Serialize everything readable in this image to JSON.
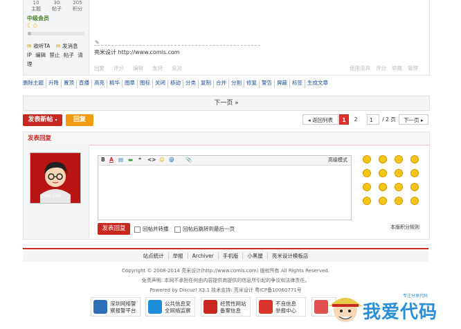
{
  "author_stats": [
    {
      "value": "10",
      "label": "主题"
    },
    {
      "value": "30",
      "label": "帖子"
    },
    {
      "value": "205",
      "label": "积分"
    }
  ],
  "author": {
    "grade": "中级会员",
    "level_progress": 0.06,
    "links_row1": [
      "收听TA",
      "发消息"
    ],
    "links_row2": [
      "IP",
      "编辑",
      "禁止",
      "帖子",
      "清理"
    ]
  },
  "post": {
    "signature": "亮米设计 http://www.comis.com",
    "actions": [
      "回复",
      "评分",
      "编辑",
      "支持",
      "反对"
    ],
    "actions_right": [
      "使用道具",
      "评分",
      "举报",
      "管理"
    ]
  },
  "mod_actions": [
    "删除主题",
    "升降",
    "置顶",
    "直播",
    "高亮",
    "精华",
    "图章",
    "图标",
    "关闭",
    "移动",
    "分类",
    "复制",
    "合并",
    "分割",
    "修复",
    "警告",
    "屏蔽",
    "标签",
    "生成文章"
  ],
  "next_page": "下一页 »",
  "buttons": {
    "new_post": "发表新帖",
    "reply": "回复"
  },
  "pagination": {
    "back": "◂ 返回列表",
    "pages": [
      "1",
      "2"
    ],
    "current": "1",
    "total": "/ 2 页",
    "next": "下一页 ▸"
  },
  "reply": {
    "header": "发表回复",
    "advanced_mode": "高级模式",
    "toolbar": [
      "B",
      "A",
      "▤",
      "▬",
      "❝",
      "<>",
      "☺",
      "@",
      "📎"
    ],
    "submit": "发表回复",
    "checkbox1": "回帖并转播",
    "checkbox2": "回帖后跳转到最后一页",
    "bonus_rules": "本版积分规则",
    "avatar_text": "COMIS.COM"
  },
  "footer": {
    "nav": [
      "站点统计",
      "举报",
      "Archiver",
      "手机版",
      "小黑屋",
      "亮米设计模板店"
    ],
    "copyright": "Copyright © 2008-2014 亮米设计(http://www.comis.com) 版权所有 All Rights Reserved.",
    "disclaimer": "免责声明: 本网不承担任何由内容提供商提供的信息所引起的争议和法律责任。",
    "powered": "Powered by Discuz! X3.1  技术支持: 亮米设计 粤ICP备10060771号",
    "badges": [
      {
        "line1": "深圳网络警",
        "line2": "察报警平台",
        "color": "#2f6fb7"
      },
      {
        "line1": "公共信息安",
        "line2": "全网络监察",
        "color": "#1d8fd8"
      },
      {
        "line1": "经营性网站",
        "line2": "备案信息",
        "color": "#c8281f"
      },
      {
        "line1": "不良信息",
        "line2": "举报中心",
        "color": "#d9352c"
      },
      {
        "line1": "",
        "line2": "",
        "color": "#e05050"
      }
    ],
    "watermark": "我爱代码",
    "watermark_small": "专注分享代码"
  }
}
